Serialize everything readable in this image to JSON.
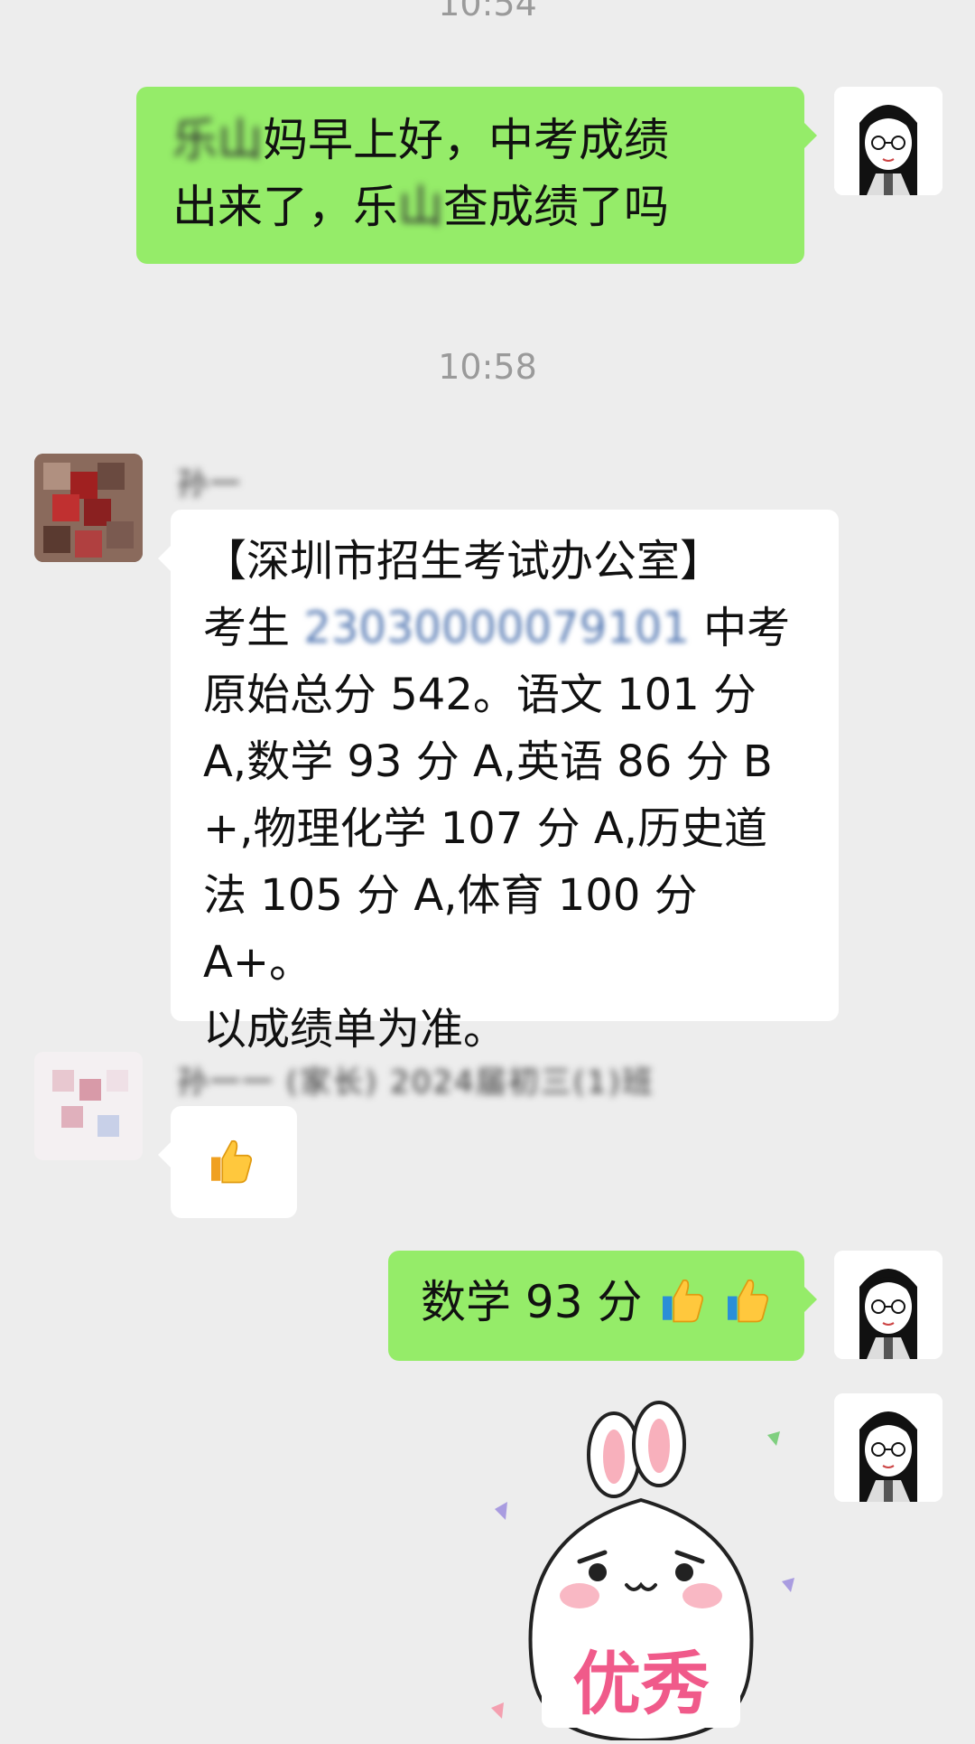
{
  "timestamps": [
    "10:54",
    "10:58"
  ],
  "messages": {
    "m1": {
      "blur_prefix": "乐山",
      "line1": "妈早上好，中考成绩",
      "line2a": "出来了，乐",
      "line2b": "山",
      "line2c": "查成绩了吗"
    },
    "m2": {
      "sender": "孙一",
      "line1": "【深圳市招生考试办公室】",
      "line2a": "考生 ",
      "exam_id": "23030000079101",
      "line2b": " 中考",
      "line3": "原始总分 542。语文 101 分",
      "line4": "A,数学 93 分 A,英语 86 分 B",
      "line5": "+,物理化学 107 分 A,历史道",
      "line6": "法 105 分 A,体育 100 分 A+。",
      "line7": "以成绩单为准。"
    },
    "m3": {
      "sender": "孙一一 (家长) 2024届初三(1)班",
      "content": "👍"
    },
    "m4": {
      "text": "数学 93 分"
    },
    "m5": {
      "sticker_text": "优秀"
    }
  },
  "colors": {
    "background": "#ededed",
    "green_bubble": "#95ec69",
    "white_bubble": "#ffffff",
    "timestamp": "#9a9a9a"
  },
  "icons": [
    "thumbs-up-icon",
    "rabbit-sticker"
  ]
}
